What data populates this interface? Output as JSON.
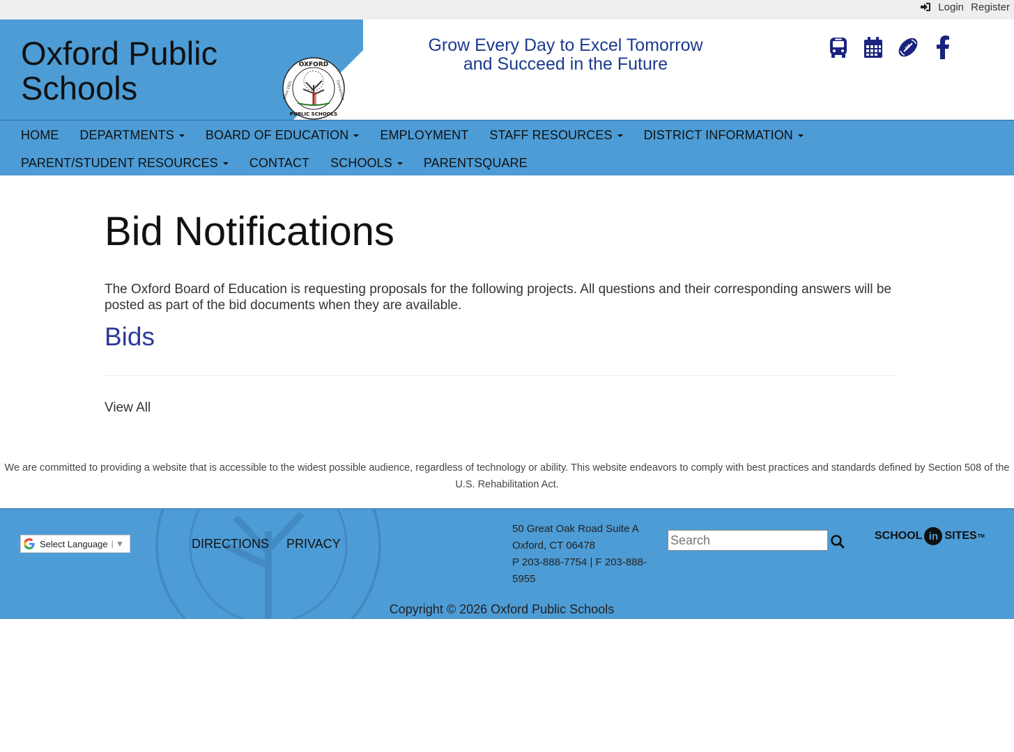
{
  "topbar": {
    "login_label": "Login",
    "register_label": "Register"
  },
  "header": {
    "site_title_line1": "Oxford Public",
    "site_title_line2": "Schools",
    "tagline_line1": "Grow Every Day to Excel Tomorrow",
    "tagline_line2": "and Succeed in the Future",
    "seal_text_top": "OXFORD",
    "seal_text_bottom": "PUBLIC SCHOOLS",
    "seal_text_left": "Since 1921",
    "seal_text_right": "Connecticut",
    "icons": [
      "bus-icon",
      "calendar-icon",
      "football-icon",
      "facebook-icon"
    ]
  },
  "nav": {
    "row1": [
      {
        "label": "HOME",
        "dropdown": false
      },
      {
        "label": "DEPARTMENTS",
        "dropdown": true
      },
      {
        "label": "BOARD OF EDUCATION",
        "dropdown": true
      },
      {
        "label": "EMPLOYMENT",
        "dropdown": false
      },
      {
        "label": "STAFF RESOURCES",
        "dropdown": true
      },
      {
        "label": "DISTRICT INFORMATION",
        "dropdown": true
      }
    ],
    "row2": [
      {
        "label": "PARENT/STUDENT RESOURCES",
        "dropdown": true
      },
      {
        "label": "CONTACT",
        "dropdown": false
      },
      {
        "label": "SCHOOLS",
        "dropdown": true
      },
      {
        "label": "PARENTSQUARE",
        "dropdown": false
      }
    ]
  },
  "main": {
    "page_title": "Bid Notifications",
    "intro": "The Oxford Board of Education is requesting proposals for the following projects. All questions and their corresponding answers will be posted as part of the bid documents when they are available.",
    "bids_heading": "Bids",
    "view_all_label": "View All"
  },
  "accessibility_statement": "We are committed to providing a website that is accessible to the widest possible audience, regardless of technology or ability. This website endeavors to comply with best practices and standards defined by Section 508 of the U.S. Rehabilitation Act.",
  "footer": {
    "translate_label": "Select Language",
    "directions_label": "DIRECTIONS",
    "privacy_label": "PRIVACY",
    "address_line1": "50 Great Oak Road Suite A",
    "address_line2": "Oxford, CT 06478",
    "phone_fax": "P 203-888-7754 | F 203-888-5955",
    "search_placeholder": "Search",
    "logo_school": "SCHOOL",
    "logo_in": "in",
    "logo_sites": "SITES",
    "logo_tm": "TM",
    "copyright": "Copyright © 2026 Oxford Public Schools"
  },
  "colors": {
    "brand_blue": "#4d9cd5",
    "tagline_blue": "#1b3a8f",
    "icon_navy": "#1a237e",
    "heading_blue": "#2b3a9a"
  }
}
